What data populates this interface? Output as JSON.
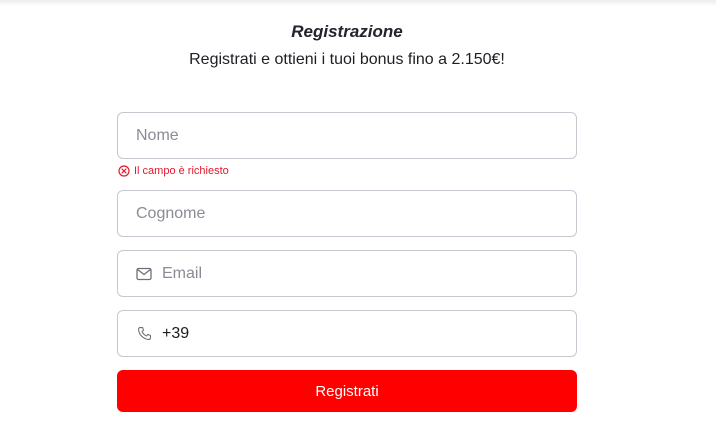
{
  "form": {
    "title": "Registrazione",
    "subtitle": "Registrati e ottieni i tuoi bonus fino a 2.150€!",
    "fields": {
      "nome": {
        "placeholder": "Nome",
        "value": ""
      },
      "cognome": {
        "placeholder": "Cognome",
        "value": ""
      },
      "email": {
        "placeholder": "Email",
        "value": "",
        "icon": "mail-icon"
      },
      "phone": {
        "placeholder": "",
        "value": "+39",
        "icon": "phone-icon"
      }
    },
    "nome_error": "Il campo è richiesto",
    "submit_label": "Registrati"
  },
  "colors": {
    "accent": "#fe0000",
    "error": "#e3182d",
    "border": "#c7c7cf",
    "placeholder": "#8b8b97"
  }
}
